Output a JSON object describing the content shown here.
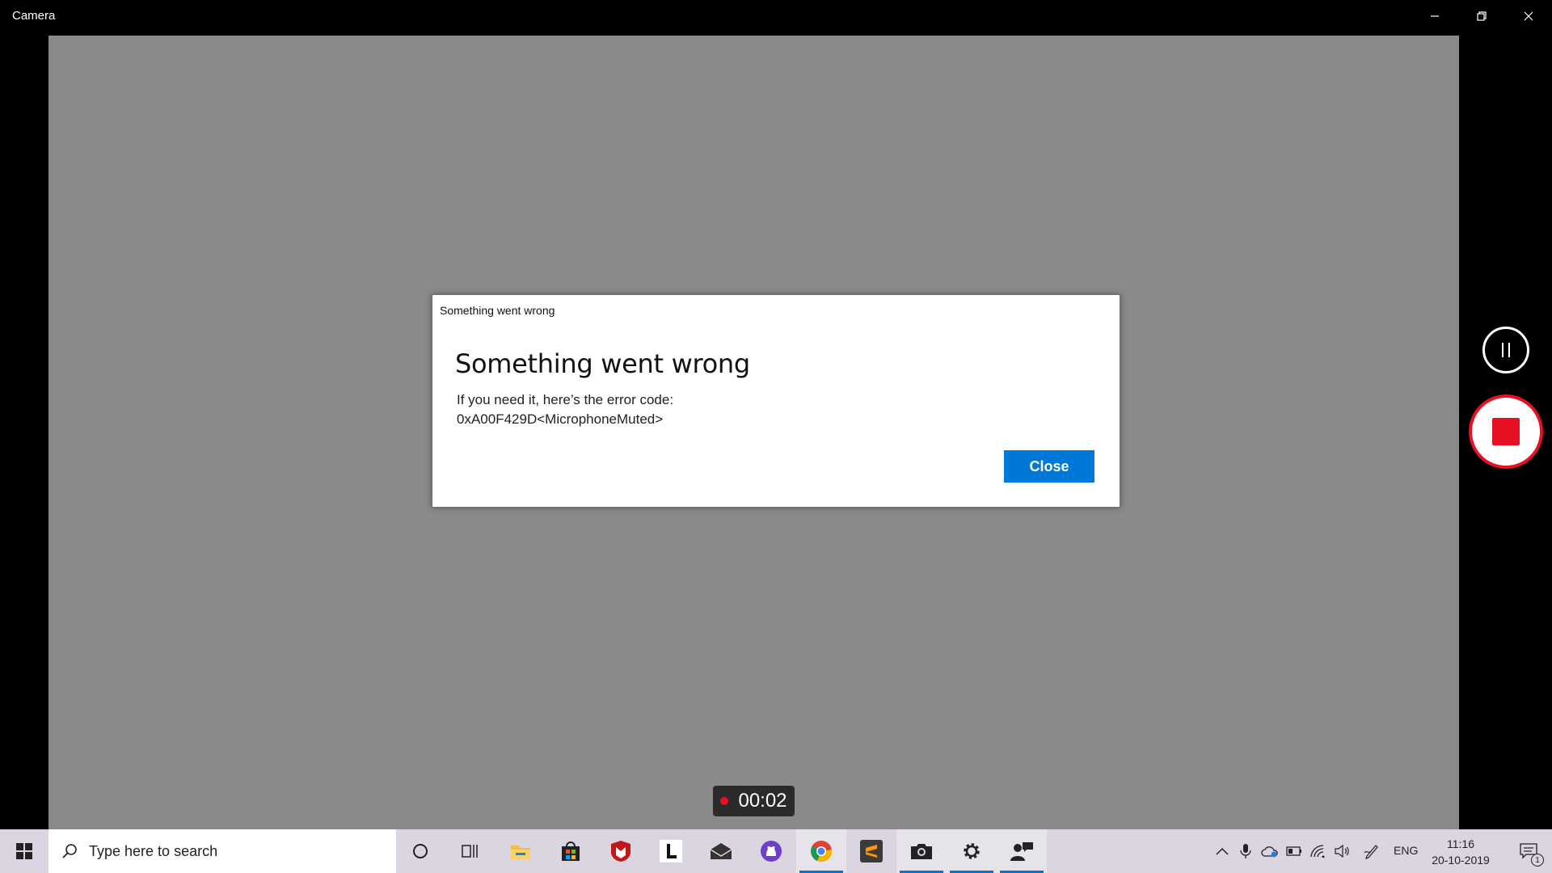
{
  "window": {
    "title": "Camera",
    "minimize_icon": "minimize-icon",
    "restore_icon": "restore-icon",
    "close_icon": "close-icon"
  },
  "dialog": {
    "caption": "Something went wrong",
    "heading": "Something went wrong",
    "message_line1": "If you need it, here’s the error code:",
    "message_line2": "0xA00F429D<MicrophoneMuted>",
    "close_label": "Close"
  },
  "recording": {
    "elapsed": "00:02"
  },
  "controls": {
    "pause_icon": "pause-icon",
    "stop_icon": "stop-icon"
  },
  "taskbar": {
    "search_placeholder": "Type here to search",
    "pinned": [
      "cortana",
      "task-view",
      "file-explorer",
      "microsoft-store",
      "mcafee",
      "l-app",
      "mail",
      "github",
      "chrome",
      "sublime-text",
      "camera",
      "settings",
      "people"
    ],
    "language": "ENG",
    "time": "11:16",
    "date": "20-10-2019",
    "notification_count": "1"
  },
  "colors": {
    "accent": "#0078d7",
    "record_red": "#e81123",
    "viewfinder": "#8a8a8c"
  }
}
